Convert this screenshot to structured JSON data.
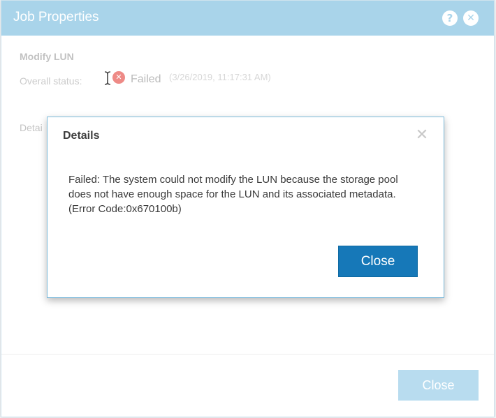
{
  "outer_dialog": {
    "title": "Job Properties",
    "help_icon_glyph": "?",
    "close_icon_glyph": "✕",
    "job_name": "Modify LUN",
    "status_label": "Overall status:",
    "status_icon_glyph": "✕",
    "status_value": "Failed",
    "status_time": "(3/26/2019, 11:17:31 AM)",
    "details_label": "Detai",
    "close_button": "Close",
    "colors": {
      "header": "#a9d4ea",
      "disabled_button": "#b8dcef"
    }
  },
  "modal": {
    "title": "Details",
    "close_icon_glyph": "✕",
    "message": "Failed: The system could not modify the LUN because the storage pool does not have enough space for the LUN and its associated metadata. (Error Code:0x670100b)",
    "close_button": "Close",
    "colors": {
      "primary_button": "#1678b8",
      "border": "#7ab9da"
    }
  },
  "icons": {
    "help": "help-icon",
    "close": "close-icon",
    "status_failed": "error-icon",
    "cursor": "text-cursor-icon"
  }
}
